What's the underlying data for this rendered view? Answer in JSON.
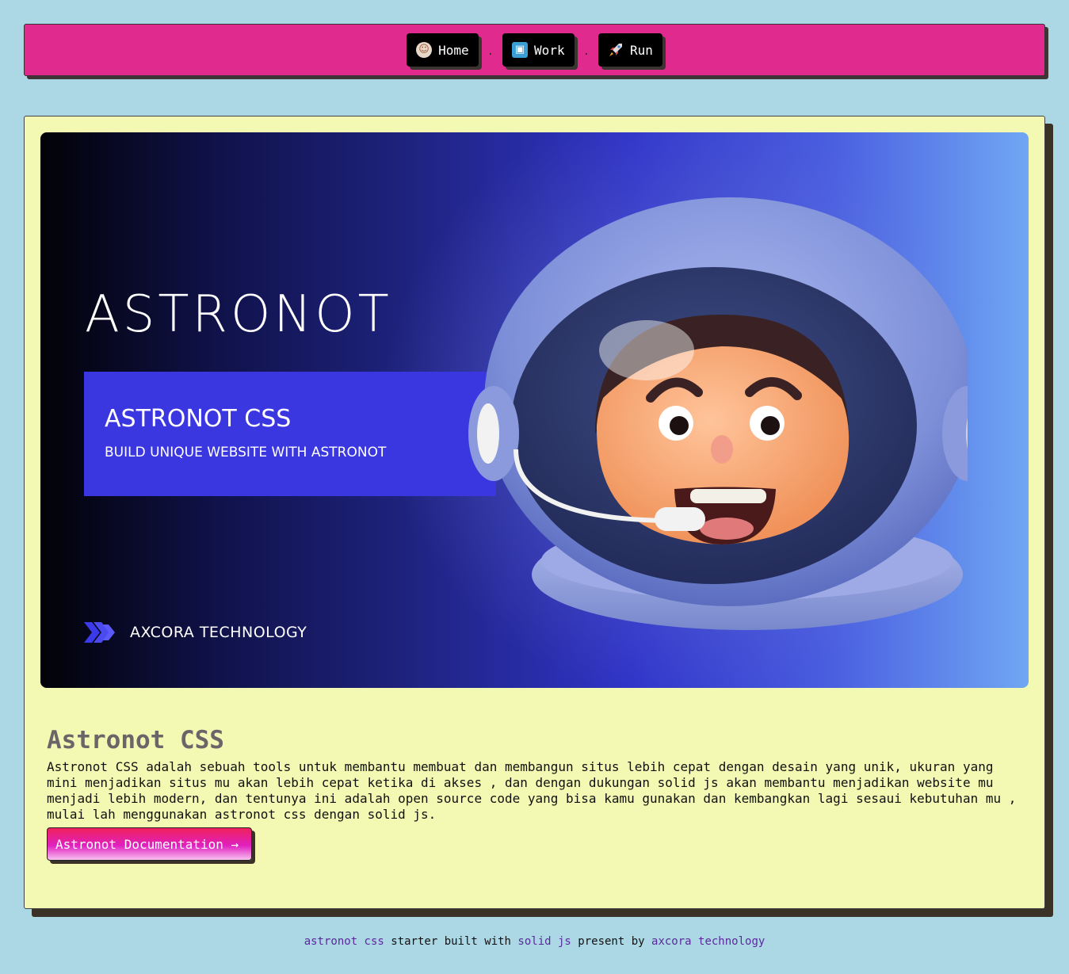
{
  "nav": {
    "items": [
      {
        "label": "Home",
        "icon": "astronaut-icon"
      },
      {
        "label": "Work",
        "icon": "technologist-icon"
      },
      {
        "label": "Run",
        "icon": "rocket-icon"
      }
    ],
    "separator": "."
  },
  "hero": {
    "title": "ASTRONOT",
    "box_title": "ASTRONOT CSS",
    "box_subtitle": "BUILD UNIQUE WEBSITE WITH ASTRONOT",
    "brand": "AXCORA TECHNOLOGY"
  },
  "content": {
    "title": "Astronot CSS",
    "description": "Astronot CSS adalah sebuah tools untuk membantu membuat dan membangun situs lebih cepat dengan desain yang unik, ukuran yang\nmini menjadikan situs mu akan lebih cepat ketika di akses , dan dengan dukungan solid js akan membantu menjadikan website mu\nmenjadi lebih modern, dan tentunya ini adalah open source code yang bisa kamu gunakan dan kembangkan lagi sesaui kebutuhan mu ,\nmulai lah menggunakan astronot css dengan solid js.",
    "button_label": "Astronot Documentation →"
  },
  "footer": {
    "link1": "astronot css",
    "text1": " starter built with ",
    "link2": "solid js",
    "text2": " present by ",
    "link3": "axcora technology"
  },
  "colors": {
    "background": "#acd8e6",
    "navbar": "#e02a8e",
    "card": "#f3f9b3",
    "hero_box": "#3a36e0"
  }
}
